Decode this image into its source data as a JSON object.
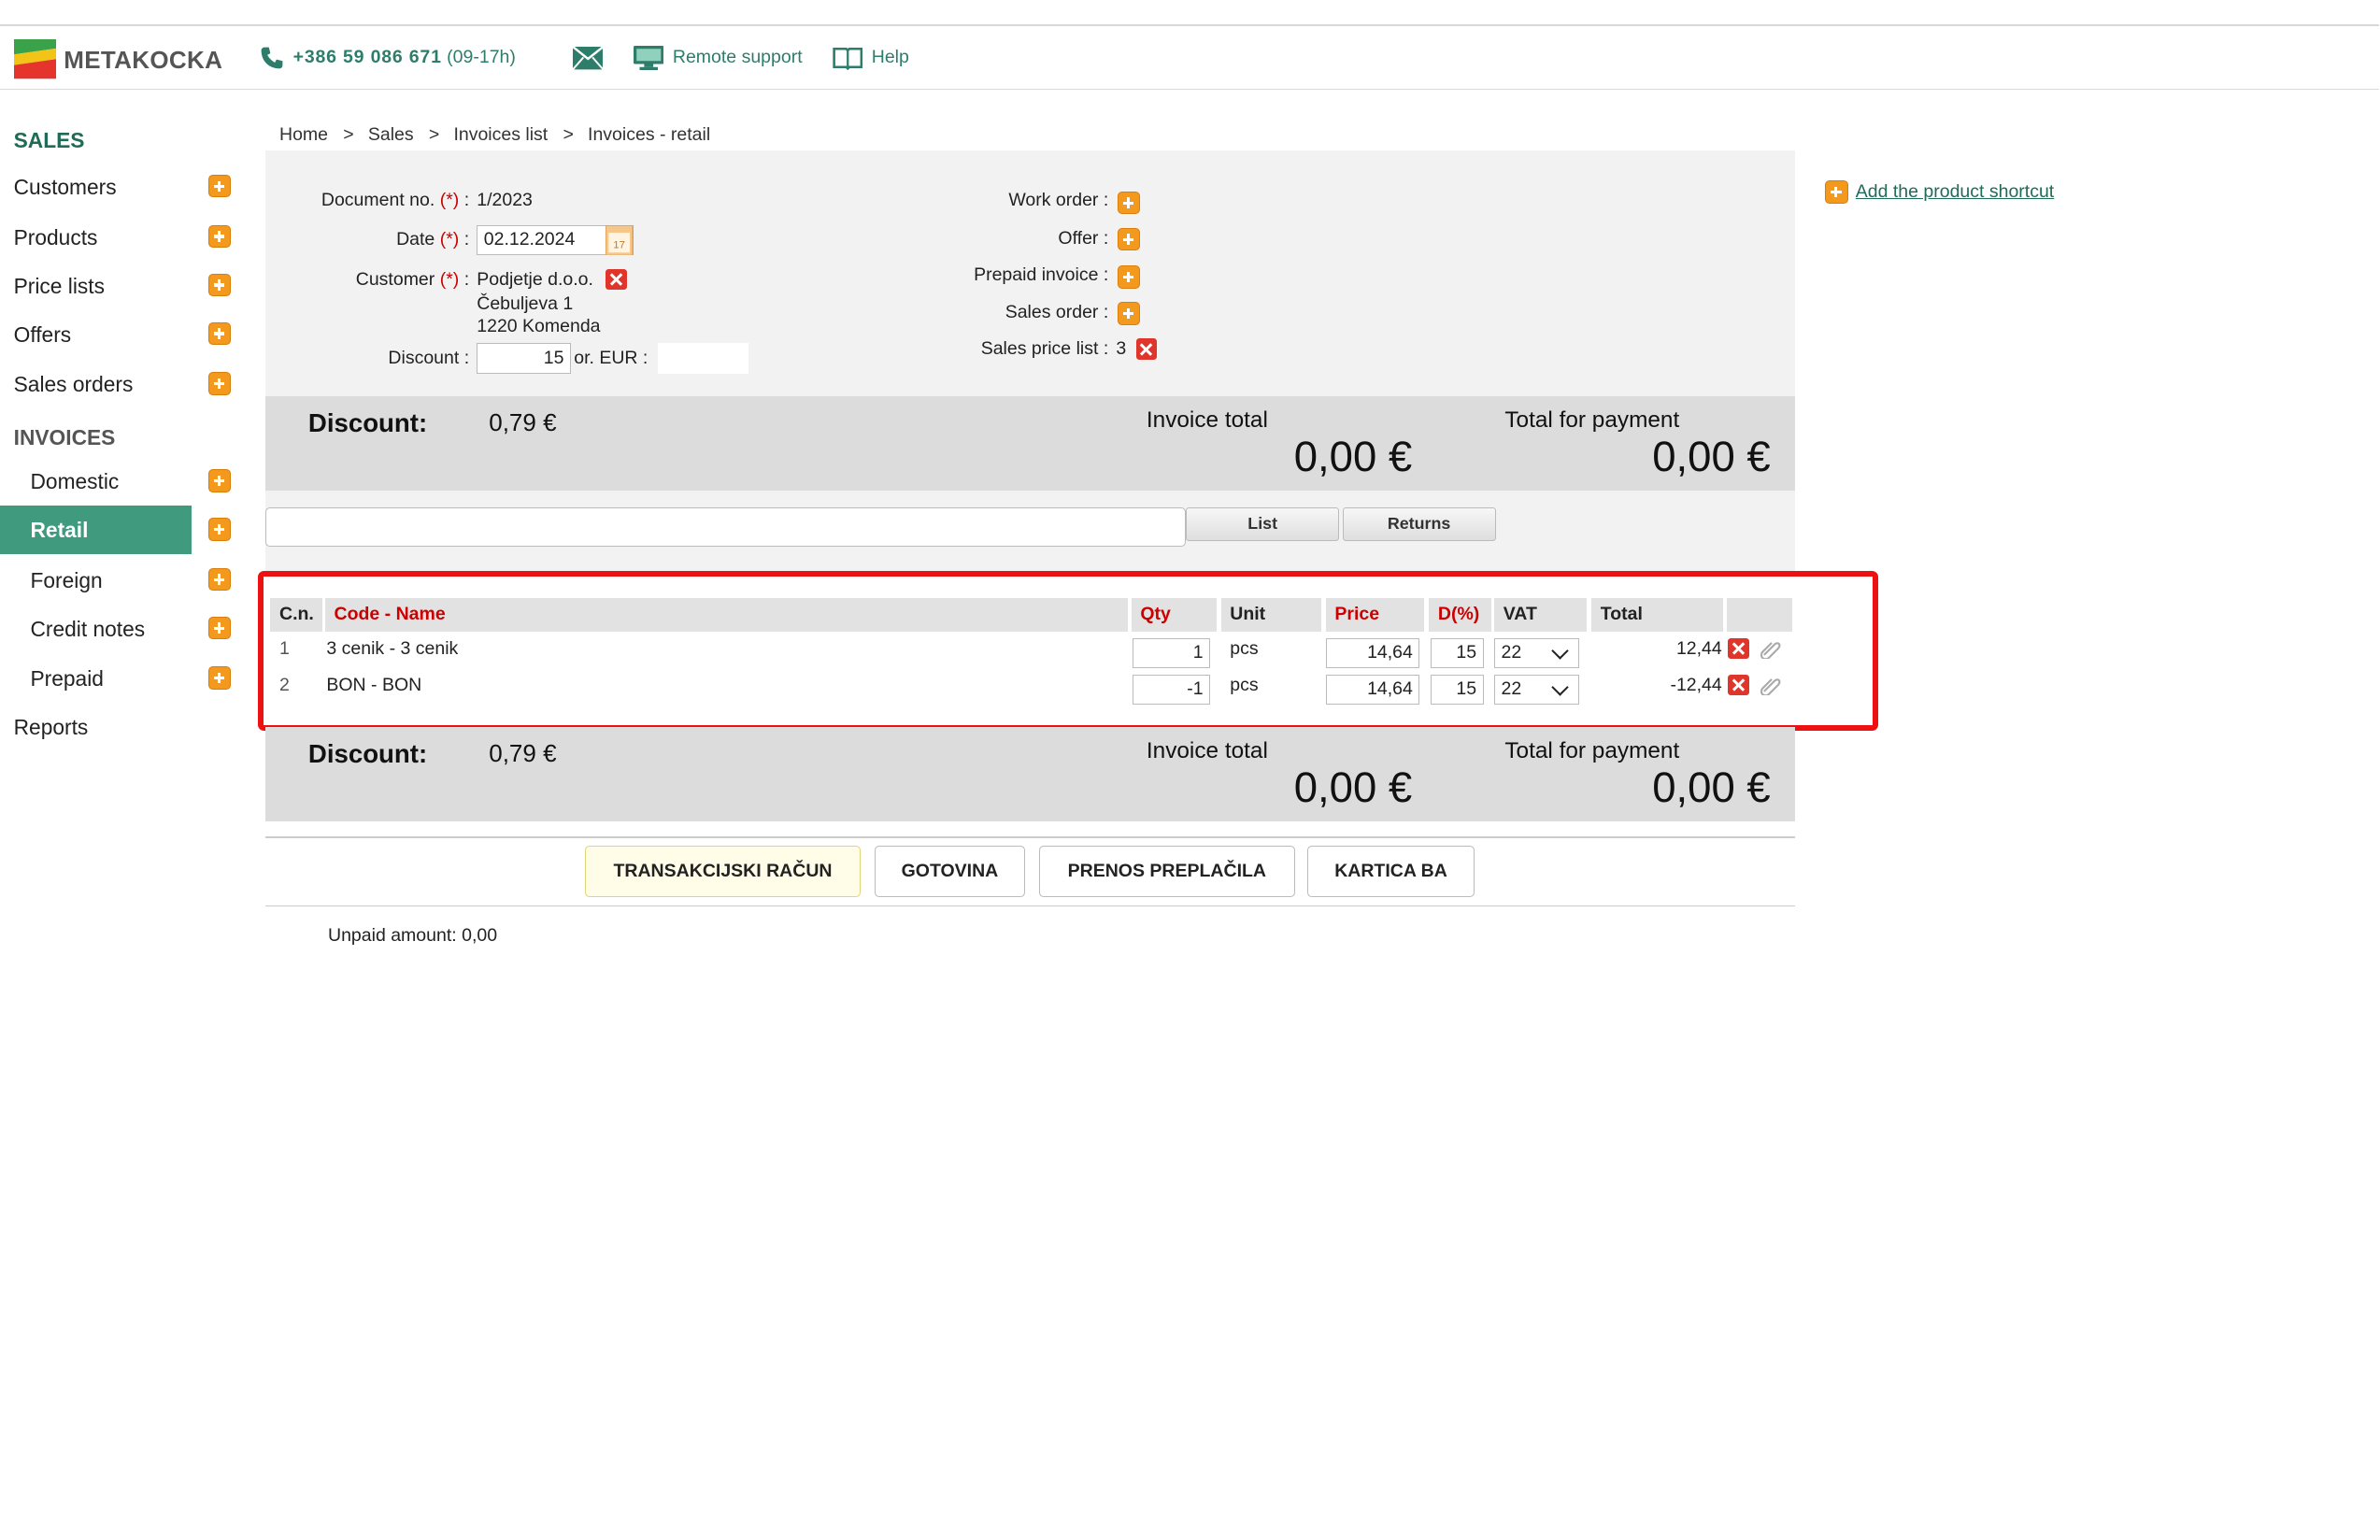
{
  "brand": {
    "name": "METAKOCKA"
  },
  "header": {
    "phone": "+386 59 086 671",
    "phone_hours": "(09-17h)",
    "remote_support": "Remote support",
    "help": "Help"
  },
  "sidebar": {
    "sales_title": "SALES",
    "sales_items": [
      {
        "label": "Customers"
      },
      {
        "label": "Products"
      },
      {
        "label": "Price lists"
      },
      {
        "label": "Offers"
      },
      {
        "label": "Sales orders"
      }
    ],
    "invoices_title": "INVOICES",
    "invoice_items": [
      {
        "label": "Domestic"
      },
      {
        "label": "Retail",
        "active": true
      },
      {
        "label": "Foreign"
      },
      {
        "label": "Credit notes"
      },
      {
        "label": "Prepaid"
      }
    ],
    "reports": "Reports"
  },
  "breadcrumb": [
    "Home",
    "Sales",
    "Invoices list",
    "Invoices - retail"
  ],
  "breadcrumb_sep": ">",
  "form": {
    "doc_no_label": "Document no.",
    "req_mark": "(*)",
    "doc_no_value": "1/2023",
    "date_label": "Date",
    "date_value": "02.12.2024",
    "customer_label": "Customer",
    "customer_name": "Podjetje d.o.o.",
    "customer_street": "Čebuljeva 1",
    "customer_city": "1220 Komenda",
    "discount_label": "Discount :",
    "discount_value": "15",
    "or_eur_label": "or. EUR :",
    "eur_value": "",
    "work_order_label": "Work order :",
    "offer_label": "Offer :",
    "prepaid_invoice_label": "Prepaid invoice :",
    "sales_order_label": "Sales order :",
    "sales_price_list_label": "Sales price list :",
    "sales_price_list_value": "3",
    "colon": ":"
  },
  "totals": {
    "discount_label": "Discount:",
    "discount_value": "0,79 €",
    "invoice_total_label": "Invoice total",
    "invoice_total_value": "0,00 €",
    "total_payment_label": "Total for payment",
    "total_payment_value": "0,00 €"
  },
  "search": {
    "value": "",
    "list_button": "List",
    "returns_button": "Returns"
  },
  "table": {
    "headers": {
      "cn": "C.n.",
      "code_name": "Code - Name",
      "qty": "Qty",
      "unit": "Unit",
      "price": "Price",
      "disc": "D(%)",
      "vat": "VAT",
      "total": "Total"
    },
    "rows": [
      {
        "cn": "1",
        "name": "3 cenik - 3 cenik",
        "qty": "1",
        "unit": "pcs",
        "price": "14,64",
        "disc": "15",
        "vat": "22",
        "total": "12,44"
      },
      {
        "cn": "2",
        "name": "BON - BON",
        "qty": "-1",
        "unit": "pcs",
        "price": "14,64",
        "disc": "15",
        "vat": "22",
        "total": "-12,44"
      }
    ]
  },
  "payment_buttons": [
    "TRANSAKCIJSKI RAČUN",
    "GOTOVINA",
    "PRENOS PREPLAČILA",
    "KARTICA BA"
  ],
  "unpaid": {
    "label": "Unpaid amount:",
    "value": "0,00"
  },
  "shortcut": {
    "label": "Add the product shortcut"
  },
  "colors": {
    "brand_green": "#1f6b58",
    "active_nav": "#3f9a7e",
    "plus_orange": "#f39a1e",
    "delete_red": "#e0352b",
    "highlight_red": "#ee1111"
  }
}
